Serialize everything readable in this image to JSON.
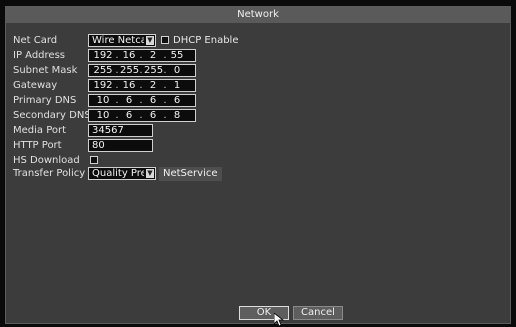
{
  "dialog": {
    "title": "Network"
  },
  "fields": {
    "net_card": {
      "label": "Net Card",
      "value": "Wire Netcarc",
      "dhcp_label": "DHCP Enable",
      "dhcp_checked": false
    },
    "ip_address": {
      "label": "IP Address",
      "octets": [
        "192",
        "16",
        "2",
        "55"
      ]
    },
    "subnet_mask": {
      "label": "Subnet Mask",
      "octets": [
        "255",
        "255",
        "255",
        "0"
      ]
    },
    "gateway": {
      "label": "Gateway",
      "octets": [
        "192",
        "16",
        "2",
        "1"
      ]
    },
    "primary_dns": {
      "label": "Primary DNS",
      "octets": [
        "10",
        "6",
        "6",
        "6"
      ]
    },
    "secondary_dns": {
      "label": "Secondary DNS",
      "octets": [
        "10",
        "6",
        "6",
        "8"
      ]
    },
    "media_port": {
      "label": "Media Port",
      "value": "34567"
    },
    "http_port": {
      "label": "HTTP Port",
      "value": "80"
    },
    "hs_download": {
      "label": "HS Download",
      "checked": false
    },
    "transfer_policy": {
      "label": "Transfer Policy",
      "value": "Quality Prefe",
      "netservice_label": "NetService"
    }
  },
  "buttons": {
    "ok": "OK",
    "cancel": "Cancel"
  },
  "icons": {
    "dropdown": "chevron-down-icon",
    "cursor": "mouse-pointer-icon"
  }
}
